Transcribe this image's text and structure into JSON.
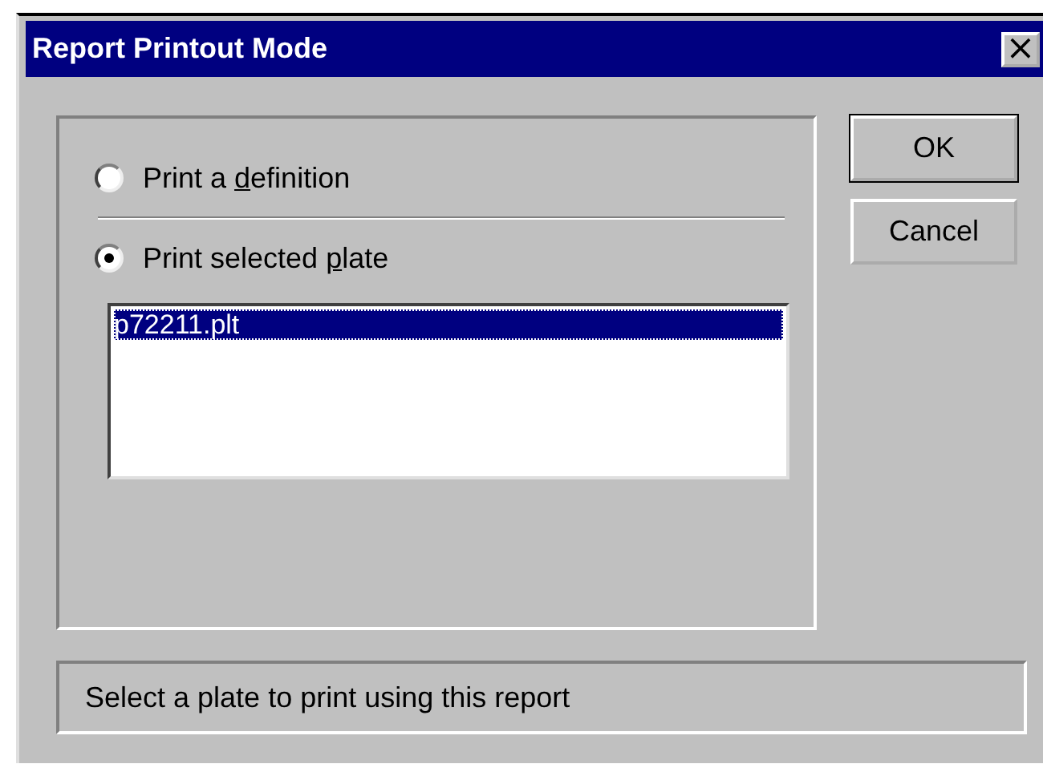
{
  "window": {
    "title": "Report Printout Mode",
    "close": "×"
  },
  "options": [
    {
      "label_parts": [
        "Print a ",
        "d",
        "efinition"
      ],
      "selected": false
    },
    {
      "label_parts": [
        "Print selected ",
        "p",
        "late"
      ],
      "selected": true
    }
  ],
  "plates": [
    {
      "name": "p72211.plt",
      "selected": true
    }
  ],
  "buttons": [
    "OK",
    "Cancel"
  ],
  "status": "Select a plate to print using this report"
}
